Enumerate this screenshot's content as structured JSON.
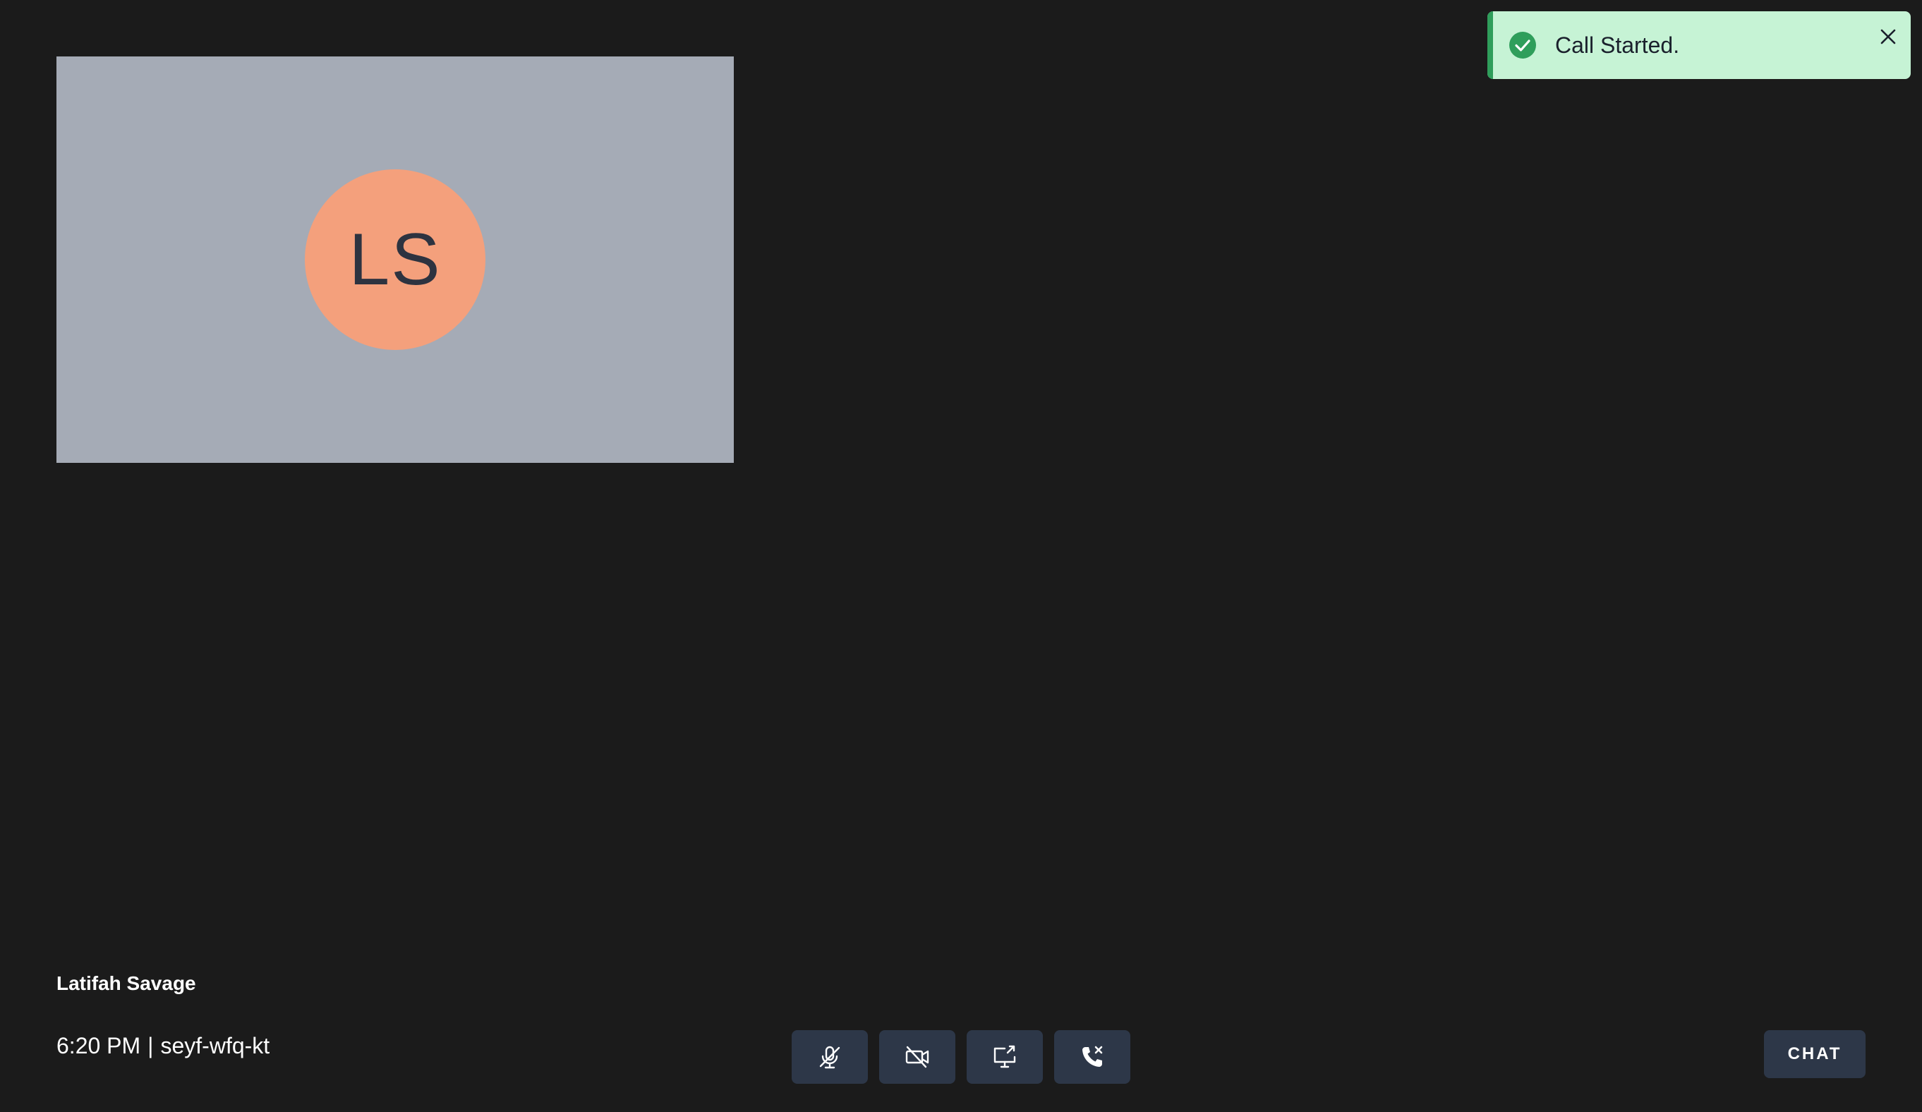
{
  "participant": {
    "initials": "LS",
    "name": "Latifah Savage"
  },
  "toast": {
    "message": "Call Started.",
    "status": "success",
    "accent_color": "#2f9e5b",
    "background_color": "#c6f3d5"
  },
  "meeting": {
    "time": "6:20 PM",
    "separator": "|",
    "code": "seyf-wfq-kt"
  },
  "controls": [
    {
      "name": "microphone-off",
      "icon": "mic-off-icon"
    },
    {
      "name": "camera-off",
      "icon": "video-off-icon"
    },
    {
      "name": "share-screen",
      "icon": "screen-share-icon"
    },
    {
      "name": "end-call",
      "icon": "phone-hangup-icon"
    }
  ],
  "chat_label": "CHAT",
  "colors": {
    "background": "#1b1b1b",
    "tile": "#a5abb6",
    "avatar": "#f4a07c",
    "button": "#2d3748"
  }
}
